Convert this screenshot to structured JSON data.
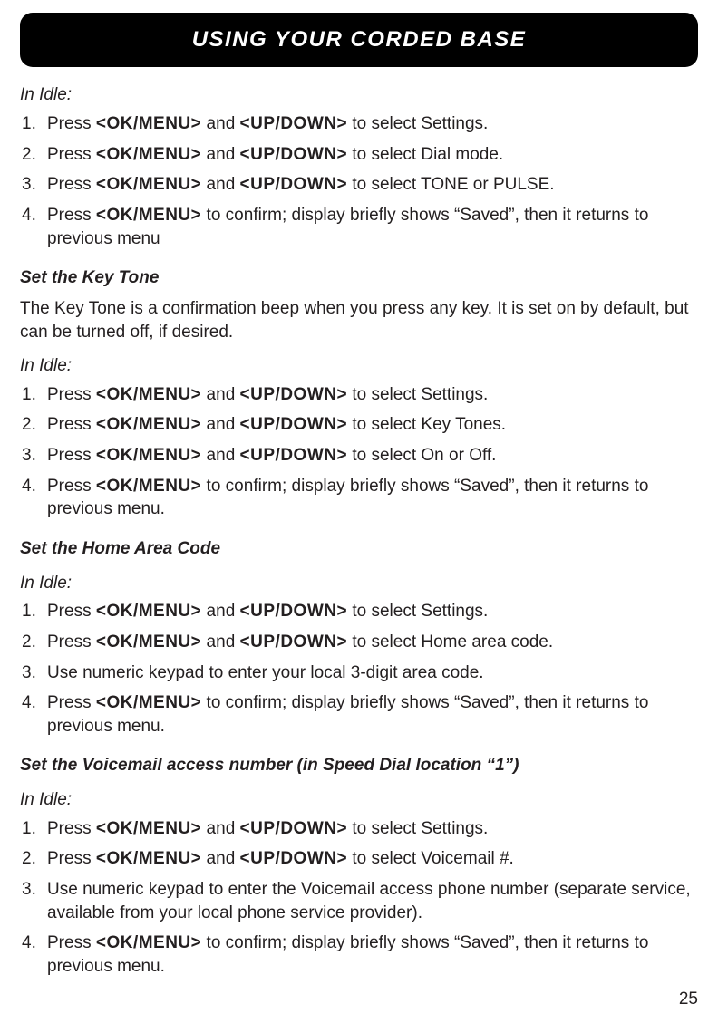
{
  "header": "USING YOUR CORDED BASE",
  "page_number": "25",
  "keys": {
    "okmenu": "<OK/MENU>",
    "updown": "<UP/DOWN>"
  },
  "sections": [
    {
      "state": "In Idle:",
      "steps": [
        {
          "pre": "Press ",
          "k1": "<OK/MENU>",
          "mid": " and ",
          "k2": "<UP/DOWN>",
          "post": " to select Settings."
        },
        {
          "pre": "Press ",
          "k1": "<OK/MENU>",
          "mid": " and ",
          "k2": "<UP/DOWN>",
          "post": " to select Dial mode."
        },
        {
          "pre": "Press ",
          "k1": "<OK/MENU>",
          "mid": " and ",
          "k2": "<UP/DOWN>",
          "post": " to select TONE or PULSE."
        },
        {
          "pre": "Press ",
          "k1": "<OK/MENU>",
          "post2": " to confirm; display briefly shows “Saved”, then it returns to previous menu"
        }
      ]
    },
    {
      "heading": "Set the Key Tone",
      "intro": "The Key Tone is a confirmation beep when you press any key. It is set on by default, but can be turned off, if desired.",
      "state": "In Idle:",
      "steps": [
        {
          "pre": "Press ",
          "k1": "<OK/MENU>",
          "mid": " and ",
          "k2": "<UP/DOWN>",
          "post": " to select Settings."
        },
        {
          "pre": "Press ",
          "k1": "<OK/MENU>",
          "mid": " and ",
          "k2": "<UP/DOWN>",
          "post": " to select Key Tones."
        },
        {
          "pre": "Press ",
          "k1": "<OK/MENU>",
          "mid": " and ",
          "k2": "<UP/DOWN>",
          "post": " to select On or Off."
        },
        {
          "pre": "Press ",
          "k1": "<OK/MENU>",
          "post2": " to confirm; display briefly shows “Saved”, then it returns to previous menu."
        }
      ]
    },
    {
      "heading": "Set the Home Area Code",
      "state": "In Idle:",
      "steps": [
        {
          "pre": "Press ",
          "k1": "<OK/MENU>",
          "mid": " and ",
          "k2": "<UP/DOWN>",
          "post": " to select Settings."
        },
        {
          "pre": "Press ",
          "k1": "<OK/MENU>",
          "mid": " and ",
          "k2": "<UP/DOWN>",
          "post": " to select Home area code."
        },
        {
          "plain": "Use numeric keypad to enter your local 3-digit area code."
        },
        {
          "pre": "Press ",
          "k1": "<OK/MENU>",
          "post2": " to confirm; display briefly shows “Saved”, then it returns to previous menu."
        }
      ]
    },
    {
      "heading": "Set the Voicemail access number (in Speed Dial location “1”)",
      "state": "In Idle:",
      "steps": [
        {
          "pre": "Press ",
          "k1": "<OK/MENU>",
          "mid": " and ",
          "k2": "<UP/DOWN>",
          "post": " to select Settings."
        },
        {
          "pre": "Press ",
          "k1": "<OK/MENU>",
          "mid": " and ",
          "k2": "<UP/DOWN>",
          "post": " to select Voicemail #."
        },
        {
          "plain": "Use numeric keypad to enter the Voicemail access phone number (separate service, available from  your local phone service provider)."
        },
        {
          "pre": "Press ",
          "k1": "<OK/MENU>",
          "post2": " to confirm; display briefly shows “Saved”, then it returns to previous menu."
        }
      ]
    }
  ]
}
